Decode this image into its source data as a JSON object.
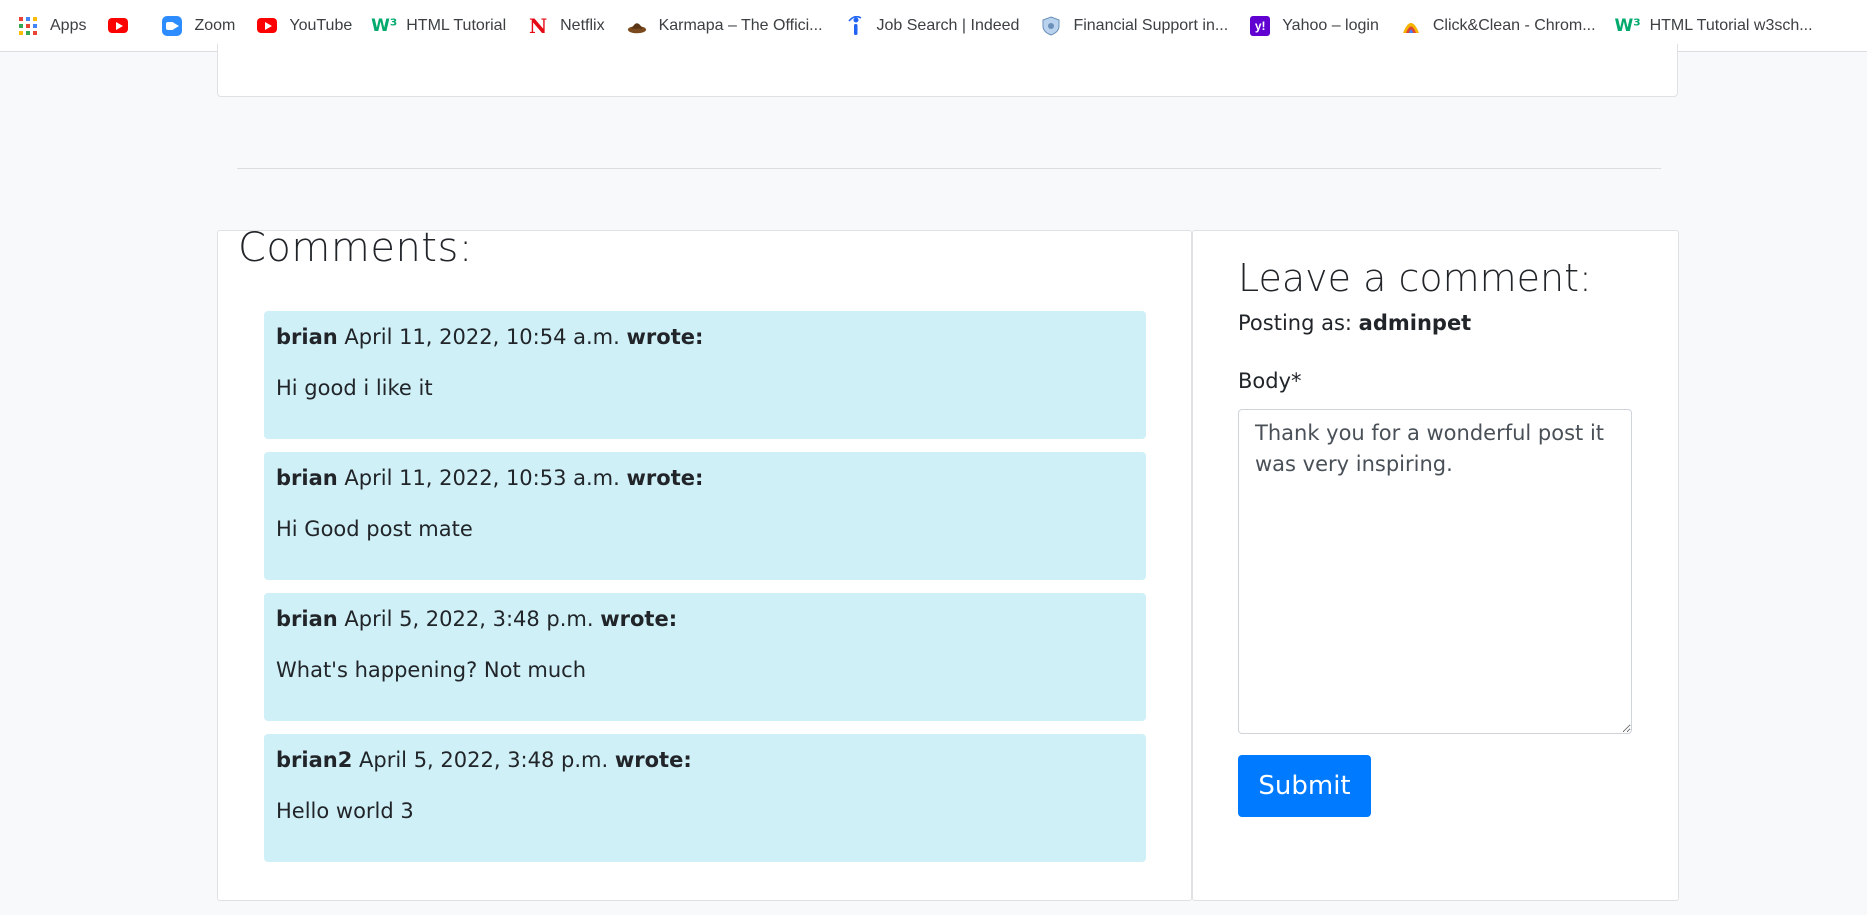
{
  "bookmarks": [
    {
      "label": "Apps",
      "icon": "apps-grid-icon"
    },
    {
      "label": "",
      "icon": "youtube-icon"
    },
    {
      "label": "Zoom",
      "icon": "zoom-icon"
    },
    {
      "label": "YouTube",
      "icon": "youtube-icon"
    },
    {
      "label": "HTML Tutorial",
      "icon": "w3schools-icon"
    },
    {
      "label": "Netflix",
      "icon": "netflix-icon"
    },
    {
      "label": "Karmapa – The Offici...",
      "icon": "karmapa-icon"
    },
    {
      "label": "Job Search | Indeed",
      "icon": "indeed-icon"
    },
    {
      "label": "Financial Support in...",
      "icon": "shield-icon"
    },
    {
      "label": "Yahoo – login",
      "icon": "yahoo-icon"
    },
    {
      "label": "Click&Clean - Chrom...",
      "icon": "clickclean-icon"
    },
    {
      "label": "HTML Tutorial w3sch...",
      "icon": "w3schools-icon"
    }
  ],
  "comments": {
    "title": "Comments:",
    "wrote_label": "wrote:",
    "items": [
      {
        "author": "brian",
        "date": "April 11, 2022, 10:54 a.m.",
        "body": "Hi good i like it"
      },
      {
        "author": "brian",
        "date": "April 11, 2022, 10:53 a.m.",
        "body": "Hi Good post mate"
      },
      {
        "author": "brian",
        "date": "April 5, 2022, 3:48 p.m.",
        "body": "What's happening? Not much"
      },
      {
        "author": "brian2",
        "date": "April 5, 2022, 3:48 p.m.",
        "body": "Hello world 3"
      }
    ]
  },
  "form": {
    "title": "Leave a comment:",
    "posting_as_label": "Posting as:",
    "username": "adminpet",
    "body_label": "Body*",
    "body_value": "Thank you for a wonderful post it was very inspiring.",
    "submit_label": "Submit"
  },
  "colors": {
    "comment_bg": "#cff0f7",
    "submit_bg": "#007bff",
    "page_bg": "#f8f9fa"
  }
}
